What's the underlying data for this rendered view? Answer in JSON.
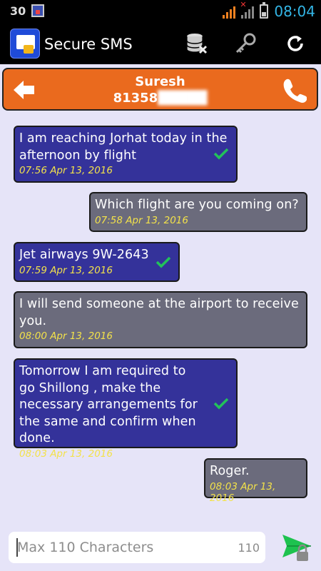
{
  "status_bar": {
    "notification_count": "30",
    "time": "08:04",
    "icons": [
      "notification-icon",
      "signal-icon",
      "battery-icon"
    ]
  },
  "app_bar": {
    "title": "Secure SMS",
    "actions": [
      "database-delete-icon",
      "key-icon",
      "refresh-icon"
    ]
  },
  "contact": {
    "name": "Suresh",
    "number": "81358"
  },
  "messages": [
    {
      "type": "sent",
      "text": "I am reaching Jorhat today in the afternoon by flight",
      "time": "07:56 Apr 13, 2016",
      "delivered": true
    },
    {
      "type": "received",
      "text": "Which flight are you coming on?",
      "time": "07:58 Apr 13, 2016",
      "delivered": false
    },
    {
      "type": "sent",
      "text": "Jet airways 9W-2643",
      "time": "07:59 Apr 13, 2016",
      "delivered": true
    },
    {
      "type": "received",
      "text": "I will send someone at the airport to receive you.",
      "time": "08:00 Apr 13, 2016",
      "delivered": false
    },
    {
      "type": "sent",
      "text": "Tomorrow I am required to go Shillong , make the necessary arrangements for the same and confirm when done.",
      "time": "08:03 Apr 13, 2016",
      "delivered": true
    },
    {
      "type": "received",
      "text": "Roger.",
      "time": "08:03 Apr 13, 2016",
      "delivered": false
    }
  ],
  "compose": {
    "placeholder": "Max 110 Characters",
    "value": "",
    "char_counter": "110"
  },
  "colors": {
    "sent_bubble": "#34329a",
    "received_bubble": "#6b6b7c",
    "timestamp": "#f3e24a",
    "contact_bar": "#ea6a1e",
    "check": "#22c25a",
    "send": "#1ec24f"
  }
}
